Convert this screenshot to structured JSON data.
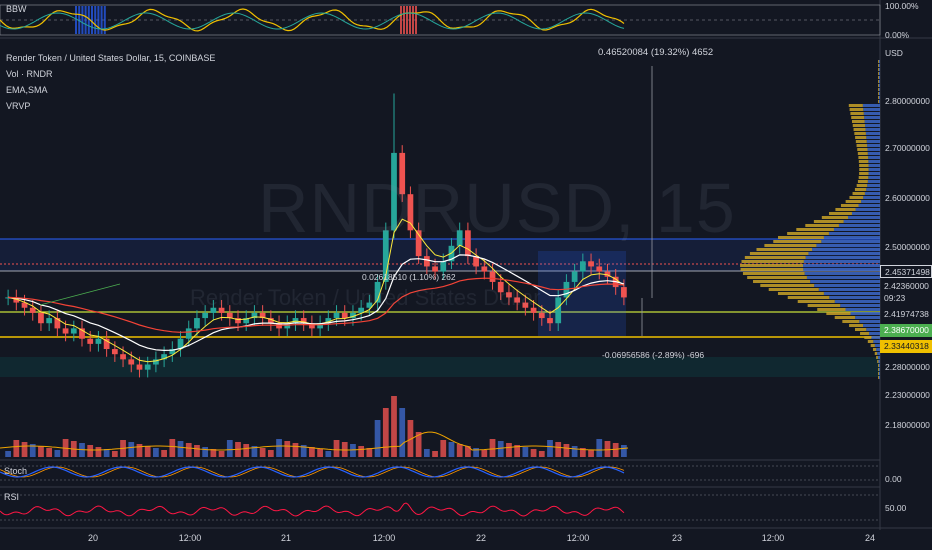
{
  "symbol_watermark": "RNDRUSD, 15",
  "symbol_watermark_sub": "Render Token / United States Dollar",
  "legend": {
    "title": "Render Token / United States Dollar, 15, COINBASE",
    "indicators": [
      "Vol · RNDR",
      "EMA,SMA",
      "VRVP"
    ]
  },
  "top_pane": {
    "title": "BBW",
    "axis_labels": [
      "100.00%",
      "0.00%"
    ]
  },
  "stoch_pane": {
    "title": "Stoch",
    "axis_label": "0.00"
  },
  "rsi_pane": {
    "title": "RSI",
    "axis_label": "50.00"
  },
  "price_axis": {
    "currency": "USD",
    "ticks": [
      "2.80000000",
      "2.70000000",
      "2.60000000",
      "2.50000000",
      "2.28000000",
      "2.23000000",
      "2.18000000"
    ],
    "tags": [
      {
        "text": "2.45371498",
        "bg": "#131722",
        "fg": "#d1d4dc",
        "border": "#d1d4dc"
      },
      {
        "text": "2.42360000",
        "bg": "#131722",
        "fg": "#d1d4dc",
        "border": "none"
      },
      {
        "text": "09:23",
        "bg": "#131722",
        "fg": "#d1d4dc",
        "border": "none"
      },
      {
        "text": "2.41974738",
        "bg": "#131722",
        "fg": "#d1d4dc",
        "border": "none"
      },
      {
        "text": "2.38670000",
        "bg": "#4caf50",
        "fg": "#ffffff",
        "border": "none"
      },
      {
        "text": "2.33440318",
        "bg": "#f0c000",
        "fg": "#131722",
        "border": "none"
      }
    ]
  },
  "time_axis": [
    "20",
    "12:00",
    "21",
    "12:00",
    "22",
    "12:00",
    "23",
    "12:00",
    "24"
  ],
  "measurements": {
    "up": "0.46520084 (19.32%) 4652",
    "small": "0.02618510 (1.10%) 262",
    "down": "-0.06956586 (-2.89%) -696"
  },
  "colors": {
    "background": "#131722",
    "up": "#26a69a",
    "down": "#ef5350",
    "ema": "#f0c000",
    "sma": "#ffffff",
    "volume_profile_up": "#3d68c8",
    "volume_profile_down": "#c9a227"
  },
  "chart_data": {
    "type": "candlestick",
    "price_range": [
      2.26,
      2.88
    ],
    "close_series": [
      2.42,
      2.41,
      2.4,
      2.39,
      2.37,
      2.38,
      2.36,
      2.35,
      2.36,
      2.34,
      2.33,
      2.34,
      2.32,
      2.31,
      2.3,
      2.29,
      2.28,
      2.29,
      2.3,
      2.31,
      2.32,
      2.34,
      2.36,
      2.38,
      2.39,
      2.4,
      2.39,
      2.38,
      2.37,
      2.38,
      2.39,
      2.38,
      2.37,
      2.36,
      2.37,
      2.38,
      2.37,
      2.36,
      2.37,
      2.38,
      2.39,
      2.38,
      2.39,
      2.4,
      2.41,
      2.45,
      2.55,
      2.7,
      2.62,
      2.55,
      2.5,
      2.48,
      2.47,
      2.49,
      2.52,
      2.55,
      2.5,
      2.48,
      2.47,
      2.45,
      2.43,
      2.42,
      2.41,
      2.4,
      2.39,
      2.38,
      2.37,
      2.42,
      2.45,
      2.47,
      2.49,
      2.48,
      2.47,
      2.46,
      2.44,
      2.42
    ]
  }
}
